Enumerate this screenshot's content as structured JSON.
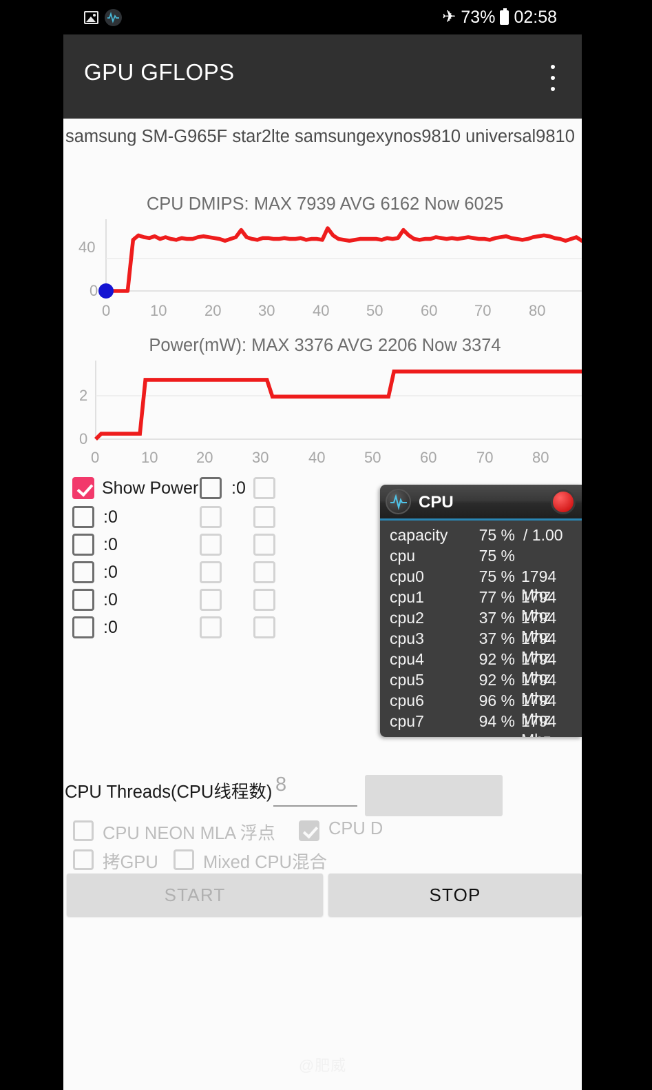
{
  "statusbar": {
    "icons_left": [
      "image-icon",
      "pulse-activity-icon"
    ],
    "airplane_icon": "✈",
    "battery_percent": "73%",
    "time": "02:58"
  },
  "appbar": {
    "title": "GPU GFLOPS",
    "overflow_icon": "overflow-menu-icon"
  },
  "device_info": "samsung SM-G965F star2lte samsungexynos9810 universal9810",
  "chart_data": [
    {
      "type": "line",
      "title": "CPU DMIPS: MAX 7939 AVG 6162 Now 6025",
      "max": 7939,
      "avg": 6162,
      "now": 6025,
      "xlabel": "",
      "ylabel": "",
      "xticks": [
        0,
        10,
        20,
        30,
        40,
        50,
        60,
        70,
        80
      ],
      "yticks": [
        0,
        40
      ],
      "xlim": [
        0,
        88
      ],
      "ylim": [
        0,
        80
      ],
      "grid": true,
      "series_color": "#ee1c1c",
      "marker": {
        "name": "start-marker",
        "color": "#1414d2",
        "x": 0,
        "y": 0
      },
      "x": [
        0,
        1,
        2,
        3,
        4,
        5,
        6,
        7,
        8,
        9,
        10,
        11,
        12,
        13,
        14,
        15,
        16,
        17,
        18,
        19,
        20,
        21,
        22,
        23,
        24,
        25,
        26,
        27,
        28,
        29,
        30,
        31,
        32,
        33,
        34,
        35,
        36,
        37,
        38,
        39,
        40,
        41,
        42,
        43,
        44,
        45,
        46,
        47,
        48,
        49,
        50,
        51,
        52,
        53,
        54,
        55,
        56,
        57,
        58,
        59,
        60,
        61,
        62,
        63,
        64,
        65,
        66,
        67,
        68,
        69,
        70,
        71,
        72,
        73,
        74,
        75,
        76,
        77,
        78,
        79,
        80,
        81,
        82,
        83,
        84,
        85,
        86,
        87,
        88
      ],
      "values": [
        0,
        0,
        0,
        0,
        0,
        57,
        62,
        60,
        59,
        61,
        58,
        60,
        58,
        57,
        59,
        58,
        58,
        60,
        61,
        60,
        59,
        58,
        56,
        58,
        60,
        68,
        60,
        58,
        57,
        59,
        59,
        58,
        58,
        59,
        58,
        58,
        59,
        57,
        58,
        58,
        57,
        70,
        62,
        58,
        57,
        56,
        57,
        58,
        58,
        58,
        58,
        57,
        59,
        58,
        59,
        68,
        62,
        58,
        57,
        58,
        58,
        60,
        59,
        58,
        59,
        58,
        59,
        60,
        59,
        58,
        58,
        57,
        59,
        60,
        61,
        59,
        58,
        57,
        58,
        60,
        61,
        62,
        61,
        59,
        58,
        56,
        58,
        60,
        56
      ]
    },
    {
      "type": "line",
      "title": "Power(mW): MAX 3376 AVG 2206 Now 3374",
      "max": 3376,
      "avg": 2206,
      "now": 3374,
      "xlabel": "",
      "ylabel": "",
      "xticks": [
        0,
        10,
        20,
        30,
        40,
        50,
        60,
        70,
        80
      ],
      "yticks": [
        0,
        2
      ],
      "xlim": [
        0,
        88
      ],
      "ylim": [
        0,
        3.6
      ],
      "grid": true,
      "series_color": "#ee1c1c",
      "x": [
        0,
        1,
        8,
        9,
        31,
        32,
        53,
        54,
        88
      ],
      "values": [
        0,
        0.25,
        0.25,
        2.72,
        2.72,
        1.95,
        1.95,
        3.1,
        3.1
      ]
    }
  ],
  "options": {
    "show_power_label": "Show Power",
    "show_power_checked": true,
    "rows": [
      {
        "label": ":0",
        "checked": false
      },
      {
        "label": ":0",
        "checked": false
      },
      {
        "label": ":0",
        "checked": false
      },
      {
        "label": ":0",
        "checked": false
      },
      {
        "label": ":0",
        "checked": false
      },
      {
        "label": ":0",
        "checked": false
      }
    ],
    "col2_first_label": ":0"
  },
  "threads": {
    "label": "CPU Threads(CPU线程数)",
    "value": "8"
  },
  "toggles": {
    "neon_mla": "CPU NEON MLA 浮点",
    "neon_checked": false,
    "cpu_dmips": "CPU D",
    "dmips_checked": true,
    "gpu_copy": "拷GPU",
    "gpu_checked": false,
    "mixed_cpu": "Mixed CPU混合",
    "mixed_checked": false
  },
  "buttons": {
    "start": "START",
    "stop": "STOP"
  },
  "cpu_overlay": {
    "title": "CPU",
    "icon": "pulse-activity-icon",
    "record_icon": "record-button-icon",
    "rows": [
      {
        "key": "capacity",
        "percent": "75 %",
        "extra": "/ 1.00",
        "freq": ""
      },
      {
        "key": "cpu",
        "percent": "75 %",
        "extra": "",
        "freq": ""
      },
      {
        "key": "cpu0",
        "percent": "75 %",
        "extra": "",
        "freq": "1794 Mhz"
      },
      {
        "key": "cpu1",
        "percent": "77 %",
        "extra": "",
        "freq": "1794 Mhz"
      },
      {
        "key": "cpu2",
        "percent": "37 %",
        "extra": "",
        "freq": "1794 Mhz"
      },
      {
        "key": "cpu3",
        "percent": "37 %",
        "extra": "",
        "freq": "1794 Mhz"
      },
      {
        "key": "cpu4",
        "percent": "92 %",
        "extra": "",
        "freq": "1794 Mhz"
      },
      {
        "key": "cpu5",
        "percent": "92 %",
        "extra": "",
        "freq": "1794 Mhz"
      },
      {
        "key": "cpu6",
        "percent": "96 %",
        "extra": "",
        "freq": "1794 Mhz"
      },
      {
        "key": "cpu7",
        "percent": "94 %",
        "extra": "",
        "freq": "1794 Mhz"
      }
    ]
  },
  "watermark": "@肥威",
  "colors": {
    "accent_pink": "#f2396b",
    "line_red": "#ee1c1c",
    "marker_blue": "#1414d2",
    "appbar": "#303030",
    "overlay_header_accent": "#2a86b4"
  }
}
